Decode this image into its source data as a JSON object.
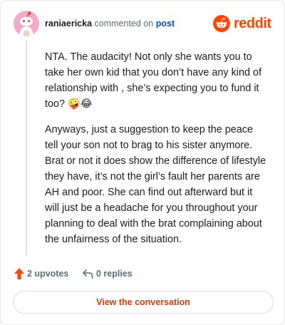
{
  "header": {
    "username": "raniaericka",
    "verb": "commented on",
    "post_link": "post",
    "brand": "reddit",
    "avatar_icon": "snoo-avatar-icon",
    "logo_icon": "reddit-snoo-icon"
  },
  "comment": {
    "paragraphs": [
      "NTA. The audacity! Not only she wants you to take her own kid that you don’t have any kind of relationship with , she’s expecting you to fund it too? 🤪😂",
      "Anyways, just a suggestion to keep the peace tell your son not to brag to his sister anymore. Brat or not it does show the difference of lifestyle they have, it’s not the girl’s fault her parents are AH and poor. She can find out afterward but it will just be a headache for you throughout your planning to deal with the brat complaining about the unfairness of the situation."
    ]
  },
  "actions": {
    "upvotes": "2 upvotes",
    "replies": "0 replies",
    "upvote_icon": "upvote-arrow-icon",
    "reply_icon": "reply-arrow-icon"
  },
  "cta": {
    "label": "View the conversation"
  },
  "colors": {
    "accent": "#ff4500",
    "link": "#0a4fb3",
    "muted": "#576f76",
    "cta_text": "#d93900",
    "avatar_bg": "#f4a9c5"
  }
}
